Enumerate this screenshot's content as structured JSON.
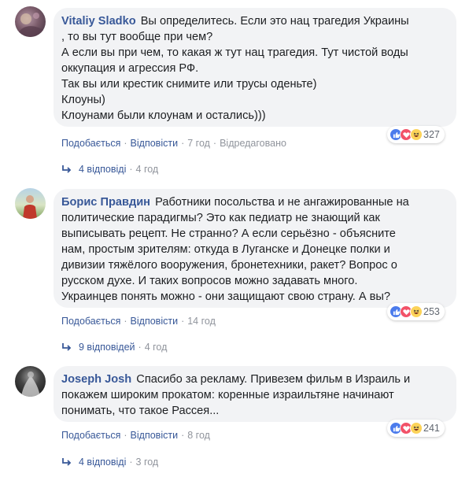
{
  "comments": [
    {
      "author": "Vitaliy Sladko",
      "lines": [
        "Вы определитесь. Если это нац трагедия Украины",
        ", то вы тут вообще при чем?",
        "А если вы при чем, то какая ж тут нац трагедия. Тут чистой воды",
        "оккупация и агрессия РФ.",
        "Так вы или крестик снимите или трусы оденьте)",
        "Клоуны)",
        "Клоунами были клоунам и остались)))"
      ],
      "reaction_count": "327",
      "like_label": "Подобається",
      "reply_label": "Відповісти",
      "time": "7 год",
      "edited_label": "Відредаговано",
      "replies_label": "4 відповіді",
      "replies_time": "4 год"
    },
    {
      "author": "Борис Правдин",
      "lines": [
        "Работники посольства и не ангажированные на",
        "политические парадигмы? Это как педиатр не знающий как",
        "выписывать рецепт. Не странно? А если серьёзно - объясните",
        "нам, простым зрителям: откуда в Луганске и Донецке полки и",
        "дивизии тяжёлого вооружения, бронетехники, ракет? Вопрос о",
        "русском духе. И таких вопросов можно задавать много.",
        "Украинцев понять можно - они защищают свою страну. А вы?"
      ],
      "reaction_count": "253",
      "like_label": "Подобається",
      "reply_label": "Відповісти",
      "time": "14 год",
      "replies_label": "9 відповідей",
      "replies_time": "4 год"
    },
    {
      "author": "Joseph Josh",
      "lines": [
        "Спасибо за рекламу. Привезем фильм в Израиль и",
        "покажем широким прокатом: коренные израильтяне начинают",
        "понимать, что такое Рассея..."
      ],
      "reaction_count": "241",
      "like_label": "Подобається",
      "reply_label": "Відповісти",
      "time": "8 год",
      "replies_label": "4 відповіді",
      "replies_time": "3 год"
    }
  ],
  "colors": {
    "author": "#385898",
    "bubble": "#f2f3f5",
    "like": "#4b7bec",
    "love": "#f25268",
    "haha": "#fcd359"
  },
  "icons": [
    "like-icon",
    "love-icon",
    "haha-icon",
    "reply-arrow-icon"
  ]
}
